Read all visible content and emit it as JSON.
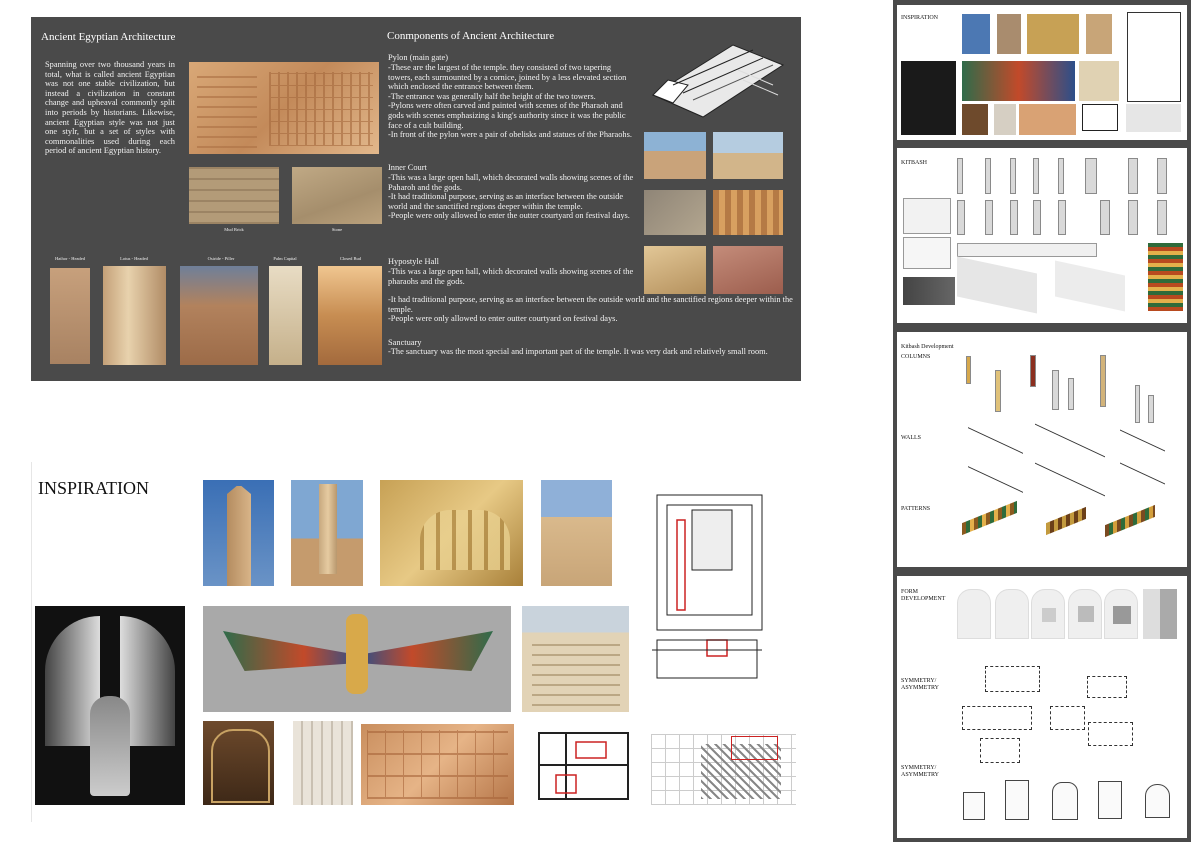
{
  "board": {
    "title_left": "Ancient Egyptian Architecture",
    "intro": "Spanning over two thousand years in total, what is called ancient Egyptian was not one stable civilization, but instead a civilization in constant change and upheaval commonly split into periods by historians. Likewise, ancient Egyptian style was not just one stylr, but a set of styles with commonalities used during each period of ancient Egyptian history.",
    "cap_mud": "Mud Brick",
    "cap_stone": "Stone",
    "columns": [
      "Hathor - Headed",
      "Lotus - Headed",
      "Osiride - Piller",
      "Palm Capital",
      "Closed Bud"
    ],
    "title_right": "Conmponents of Ancient Architecture",
    "pylon_title": "Pylon (main gate)",
    "pylon_text": "-These are the largest of the temple. they consisted of two tapering towers, each surmounted by a cornice, joined by a less elevated section which enclosed the entrance between them.\n-The entrance was generally half the height of the two towers.\n-Pylons were often carved and painted with scenes of the Pharaoh and gods with scenes emphasizing a king's authority since it was the public face of a cult building.\n-In front of the pylon were a pair of obelisks and statues of the Pharaohs.",
    "court_title": "Inner Court",
    "court_text": "-This was a large open hall, which decorated walls showing scenes of the Paharoh and the gods.\n-It had traditional purpose, serving as an interface between the outside world and the sanctified regions deeper within the temple.\n-People were only allowed to enter the outter courtyard on festival days.",
    "hypo_title": "Hypostyle Hall",
    "hypo_text": "-This was a large open hall, which decorated walls showing scenes of the pharaohs and the gods.",
    "hypo_text2": "-It had traditional purpose, serving as an interface between the outside world and the sanctified regions deeper within the temple.\n-People were only allowed to enter outter courtyard on festival days.",
    "sanct_title": "Sanctuary",
    "sanct_text": "-The sanctuary was the most special and important part of the temple. It was very dark and relatively small room."
  },
  "inspiration": {
    "title": "INSPIRATION"
  },
  "sidebar": {
    "inspiration": "INSPIRATION",
    "kitbash": "KITBASH",
    "kitbash_dev": "Kitbash Development",
    "columns": "COLUMNS",
    "walls": "WALLS",
    "patterns": "PATTERNS",
    "form_dev": "FORM\nDEVELOPMENT",
    "sym1": "SYMMETRY/\nASYMMETRY",
    "sym2": "SYMMETRY/\nASYMMETRY"
  }
}
